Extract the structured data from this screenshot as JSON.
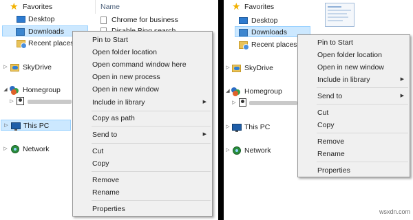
{
  "left": {
    "nav": {
      "favorites": "Favorites",
      "desktop": "Desktop",
      "downloads": "Downloads",
      "recent_places": "Recent places",
      "skydrive": "SkyDrive",
      "homegroup": "Homegroup",
      "this_pc": "This PC",
      "network": "Network"
    },
    "column_header": "Name",
    "files": [
      "Chrome for business",
      "Disable Bing search"
    ],
    "context_menu": {
      "pin_to_start": "Pin to Start",
      "open_folder_location": "Open folder location",
      "open_command_window": "Open command window here",
      "open_in_new_process": "Open in new process",
      "open_in_new_window": "Open in new window",
      "include_in_library": "Include in library",
      "copy_as_path": "Copy as path",
      "send_to": "Send to",
      "cut": "Cut",
      "copy": "Copy",
      "remove": "Remove",
      "rename": "Rename",
      "properties": "Properties"
    }
  },
  "right": {
    "nav": {
      "favorites": "Favorites",
      "desktop": "Desktop",
      "downloads": "Downloads",
      "recent_places": "Recent places",
      "skydrive": "SkyDrive",
      "homegroup": "Homegroup",
      "this_pc": "This PC",
      "network": "Network"
    },
    "context_menu": {
      "pin_to_start": "Pin to Start",
      "open_folder_location": "Open folder location",
      "open_in_new_window": "Open in new window",
      "include_in_library": "Include in library",
      "send_to": "Send to",
      "cut": "Cut",
      "copy": "Copy",
      "remove": "Remove",
      "rename": "Rename",
      "properties": "Properties"
    }
  },
  "watermark": "wsxdn.com",
  "icons": [
    "star-icon",
    "desktop-icon",
    "downloads-folder-icon",
    "recent-places-icon",
    "skydrive-icon",
    "homegroup-icon",
    "user-icon",
    "this-pc-icon",
    "network-icon",
    "file-icon",
    "chevron-right-icon"
  ],
  "colors": {
    "selection_bg": "#cce8ff",
    "selection_border": "#99d1ff",
    "menu_bg": "#f0f0f0",
    "divider": "#000000"
  }
}
